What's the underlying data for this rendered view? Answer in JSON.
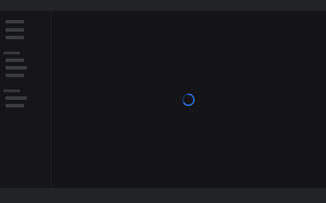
{
  "app": {
    "state": "loading"
  },
  "spinner": {
    "icon": "loading-spinner-icon",
    "color": "#2f6fe0"
  },
  "colors": {
    "background": "#141416",
    "chrome": "#222325",
    "skeleton": "#3b3c40"
  }
}
